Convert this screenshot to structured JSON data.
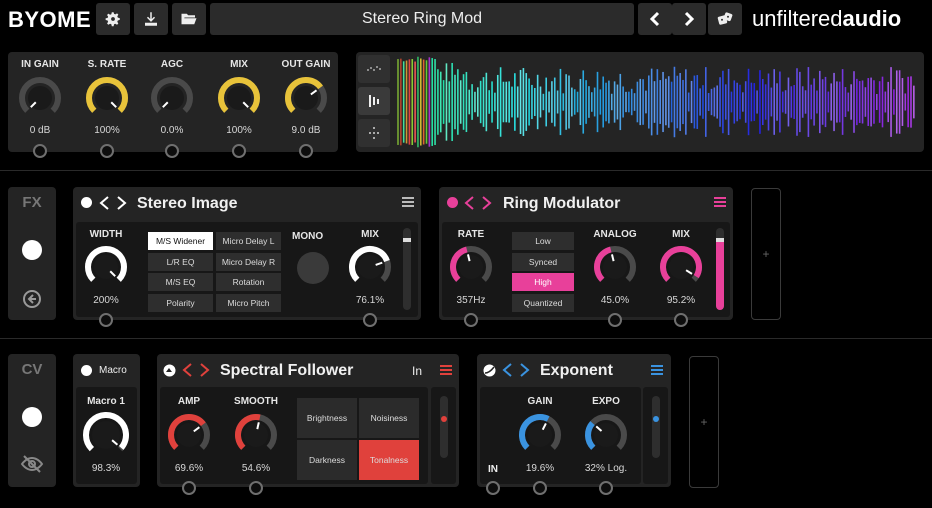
{
  "header": {
    "brand_logo": "BYOME",
    "preset_name": "Stereo Ring Mod",
    "company": "unfiltered",
    "company_bold": "audio",
    "icons": [
      "gear-icon",
      "download-icon",
      "folder-icon",
      "chevron-left-icon",
      "chevron-right-icon",
      "dice-icon"
    ]
  },
  "io": {
    "knobs": [
      {
        "label": "IN GAIN",
        "value": "0 dB",
        "level": 0.0,
        "color": "#555555"
      },
      {
        "label": "S. RATE",
        "value": "100%",
        "level": 1.0,
        "color": "#e8c33a"
      },
      {
        "label": "AGC",
        "value": "0.0%",
        "level": 0.0,
        "color": "#555555"
      },
      {
        "label": "MIX",
        "value": "100%",
        "level": 1.0,
        "color": "#e8c33a"
      },
      {
        "label": "OUT GAIN",
        "value": "9.0 dB",
        "level": 0.7,
        "color": "#e8c33a"
      }
    ]
  },
  "rows": {
    "fx_label": "FX",
    "cv_label": "CV"
  },
  "stereo_image": {
    "title": "Stereo Image",
    "width_label": "WIDTH",
    "width_value": "200%",
    "width_level": 1.0,
    "modes": [
      {
        "label": "M/S Widener",
        "selected": true
      },
      {
        "label": "Micro Delay L",
        "selected": false
      },
      {
        "label": "L/R EQ",
        "selected": false
      },
      {
        "label": "Micro Delay R",
        "selected": false
      },
      {
        "label": "M/S EQ",
        "selected": false
      },
      {
        "label": "Rotation",
        "selected": false
      },
      {
        "label": "Polarity",
        "selected": false
      },
      {
        "label": "Micro Pitch",
        "selected": false
      }
    ],
    "mono_label": "MONO",
    "mix_label": "MIX",
    "mix_value": "76.1%",
    "mix_level": 0.761,
    "accent": "#ffffff"
  },
  "ring_mod": {
    "title": "Ring Modulator",
    "rate_label": "RATE",
    "rate_value": "357Hz",
    "rate_level": 0.45,
    "modes": [
      {
        "label": "Low",
        "selected": false
      },
      {
        "label": "Synced",
        "selected": false
      },
      {
        "label": "High",
        "selected": true
      },
      {
        "label": "Quantized",
        "selected": false
      }
    ],
    "analog_label": "ANALOG",
    "analog_value": "45.0%",
    "analog_level": 0.45,
    "mix_label": "MIX",
    "mix_value": "95.2%",
    "mix_level": 0.952,
    "accent": "#e8409a"
  },
  "macro": {
    "title": "Macro",
    "knob_label": "Macro 1",
    "knob_value": "98.3%",
    "knob_level": 0.983
  },
  "spectral_follower": {
    "title": "Spectral Follower",
    "in_label": "In",
    "amp_label": "AMP",
    "amp_value": "69.6%",
    "amp_level": 0.696,
    "smooth_label": "SMOOTH",
    "smooth_value": "54.6%",
    "smooth_level": 0.546,
    "modes": [
      {
        "label": "Brightness",
        "selected": false
      },
      {
        "label": "Noisiness",
        "selected": false
      },
      {
        "label": "Darkness",
        "selected": false
      },
      {
        "label": "Tonalness",
        "selected": true
      }
    ],
    "accent": "#e0413c"
  },
  "exponent": {
    "title": "Exponent",
    "gain_label": "GAIN",
    "gain_value": "19.6%",
    "gain_level": 0.6,
    "expo_label": "EXPO",
    "expo_value": "32% Log.",
    "expo_level": 0.32,
    "in_label": "IN",
    "accent": "#3a93e0"
  }
}
